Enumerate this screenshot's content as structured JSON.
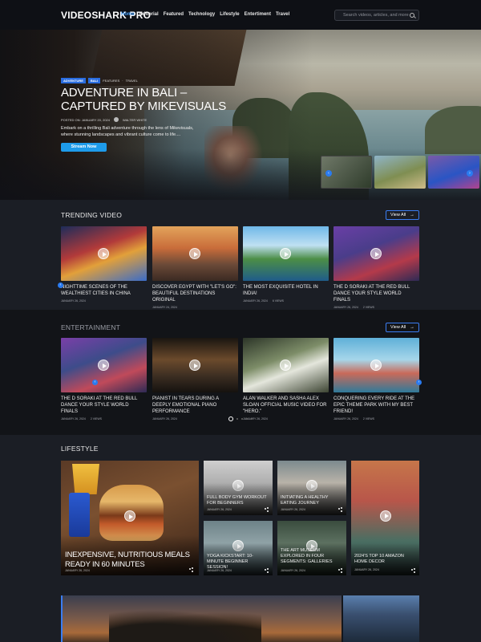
{
  "header": {
    "logo": "VIDEOSHARK PRO",
    "nav": [
      "Home",
      "Editorial",
      "Featured",
      "Technology",
      "Lifestyle",
      "Entertiment",
      "Travel"
    ],
    "active_nav": "Home",
    "search_placeholder": "Search videos, articles, and more"
  },
  "hero": {
    "tags": [
      "ADVENTURE",
      "BALI"
    ],
    "tag_text": [
      "FEATURES",
      "TRAVEL"
    ],
    "title": "ADVENTURE IN BALI – CAPTURED BY MIKEVISUALS",
    "posted": "POSTED ON: JANUARY 20, 2024",
    "author": "WALTER WHITE",
    "description": "Embark on a thrilling Bali adventure through the lens of Mikevisuals, where stunning landscapes and vibrant culture come to life....",
    "button": "Stream Now"
  },
  "trending": {
    "title": "TRENDING VIDEO",
    "view_all": "View All",
    "items": [
      {
        "title": "NIGHTTIME SCENES OF THE WEALTHIEST CITIES IN CHINA",
        "date": "JANUARY 26, 2024",
        "views": ""
      },
      {
        "title": "DISCOVER EGYPT WITH \"LET'S GO\": BEAUTIFUL DESTINATIONS ORIGINAL",
        "date": "JANUARY 24, 2024",
        "views": ""
      },
      {
        "title": "THE MOST EXQUISITE HOTEL IN INDIA!",
        "date": "JANUARY 26, 2024",
        "views": "6 VIEWS"
      },
      {
        "title": "THE D SORAKI AT THE RED BULL DANCE YOUR STYLE WORLD FINALS",
        "date": "JANUARY 26, 2024",
        "views": "2 VIEWS"
      }
    ]
  },
  "entertainment": {
    "title": "ENTERTAINMENT",
    "view_all": "View All",
    "items": [
      {
        "title": "THE D SORAKI AT THE RED BULL DANCE YOUR STYLE WORLD FINALS",
        "date": "JANUARY 26, 2024",
        "views": "2 VIEWS"
      },
      {
        "title": "PIANIST IN TEARS DURING A DEEPLY EMOTIONAL PIANO PERFORMANCE",
        "date": "JANUARY 26, 2024",
        "views": ""
      },
      {
        "title": "ALAN WALKER AND SASHA ALEX SLOAN OFFICIAL MUSIC VIDEO FOR \"HERO.\"",
        "date": "JANUARY 26, 2024",
        "views": ""
      },
      {
        "title": "CONQUERING EVERY RIDE AT THE EPIC THEME PARK WITH MY BEST FRIEND!",
        "date": "JANUARY 26, 2024",
        "views": "2 VIEWS"
      }
    ]
  },
  "lifestyle": {
    "title": "LIFESTYLE",
    "big": {
      "title": "INEXPENSIVE, NUTRITIOUS MEALS READY IN 60 MINUTES",
      "date": "JANUARY 26, 2024"
    },
    "items": [
      {
        "title": "FULL BODY GYM WORKOUT FOR BEGINNERS",
        "date": "JANUARY 26, 2024"
      },
      {
        "title": "INITIATING A HEALTHY EATING JOURNEY",
        "date": "JANUARY 26, 2024"
      },
      {
        "title": "2024'S TOP 10 AMAZON HOME DECOR",
        "date": "JANUARY 26, 2024"
      },
      {
        "title": "YOGA KICKSTART: 10-MINUTE BEGINNER SESSION!",
        "date": "JANUARY 26, 2024"
      },
      {
        "title": "THE ART MUSEUM EXPLORED IN FOUR SEGMENTS: GALLERIES",
        "date": "JANUARY 26, 2024"
      }
    ]
  },
  "colors": {
    "accent": "#1e9bea",
    "brand_blue": "#3b7df2",
    "background": "#14161c"
  }
}
